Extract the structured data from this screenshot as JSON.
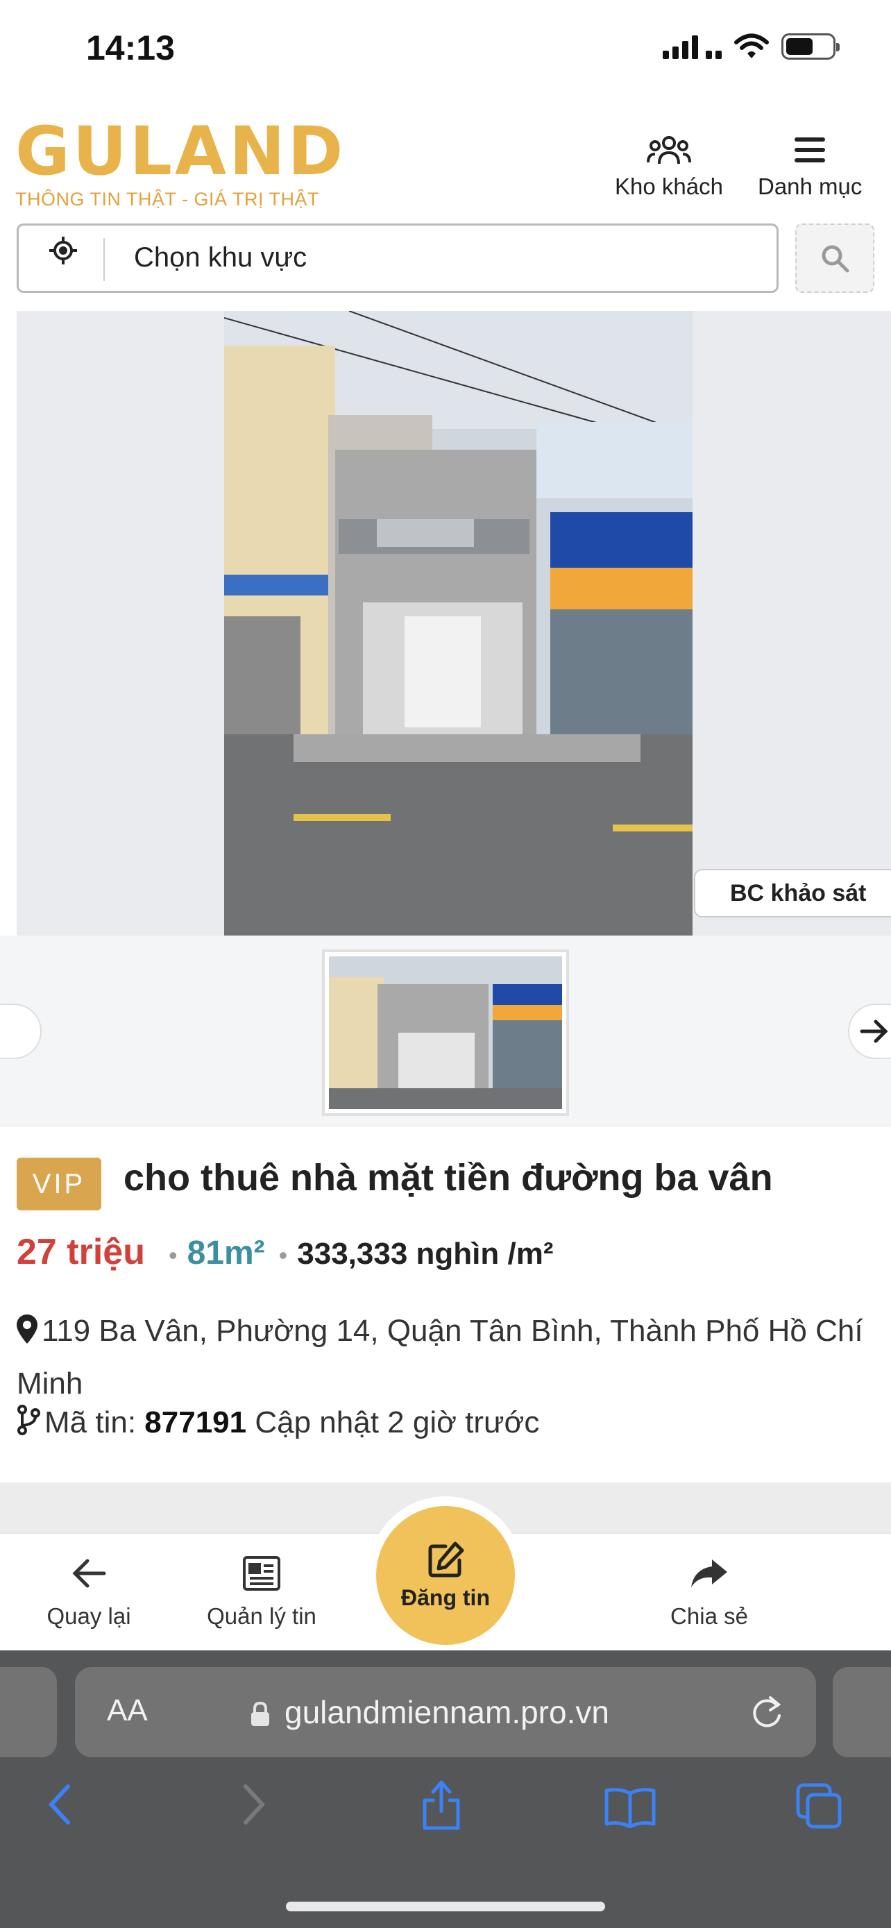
{
  "status_bar": {
    "time": "14:13"
  },
  "header": {
    "logo_text": "GULAND",
    "tagline": "THÔNG TIN THẬT - GIÁ TRỊ THẬT",
    "customers_label": "Kho khách",
    "menu_label": "Danh mục"
  },
  "search": {
    "area_placeholder": "Chọn khu vực"
  },
  "gallery": {
    "survey_button": "BC khảo sát"
  },
  "listing": {
    "badge": "VIP",
    "title": "cho thuê nhà mặt tiền đường ba vân",
    "price": "27 triệu",
    "area": "81m²",
    "price_per_m2": "333,333 nghìn /m²",
    "address": "119 Ba Vân, Phường 14, Quận Tân Bình, Thành Phố Hồ Chí Minh",
    "code_label": "Mã tin:",
    "code_value": "877191",
    "updated": "Cập nhật 2 giờ trước"
  },
  "bottom_bar": {
    "back_label": "Quay lại",
    "manage_label": "Quản lý tin",
    "post_label": "Đăng tin",
    "share_label": "Chia sẻ"
  },
  "browser": {
    "aa_label": "AA",
    "url": "gulandmiennam.pro.vn"
  },
  "colors": {
    "brand_gold": "#e8b34a",
    "price_red": "#d0413b",
    "area_teal": "#3a8fa0",
    "fab_yellow": "#f2c25a",
    "browser_accent": "#3b82f6"
  }
}
